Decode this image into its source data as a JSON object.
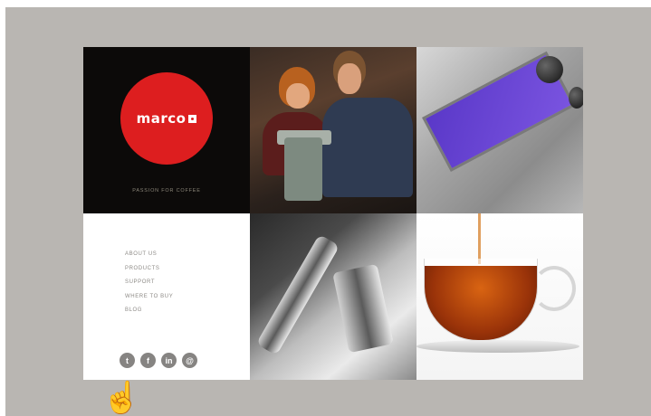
{
  "brand": {
    "logo_text": "marco",
    "tagline": "PASSION FOR COFFEE",
    "accent": "#dd1e1f"
  },
  "nav": {
    "items": [
      {
        "label": "ABOUT US"
      },
      {
        "label": "PRODUCTS"
      },
      {
        "label": "SUPPORT"
      },
      {
        "label": "WHERE TO BUY"
      },
      {
        "label": "BLOG"
      }
    ]
  },
  "social": [
    {
      "icon": "twitter-icon",
      "glyph": "t"
    },
    {
      "icon": "facebook-icon",
      "glyph": "f"
    },
    {
      "icon": "linkedin-icon",
      "glyph": "in"
    },
    {
      "icon": "email-icon",
      "glyph": "@"
    }
  ],
  "cursor": {
    "icon": "hand-pointer-icon",
    "glyph": "☝"
  }
}
